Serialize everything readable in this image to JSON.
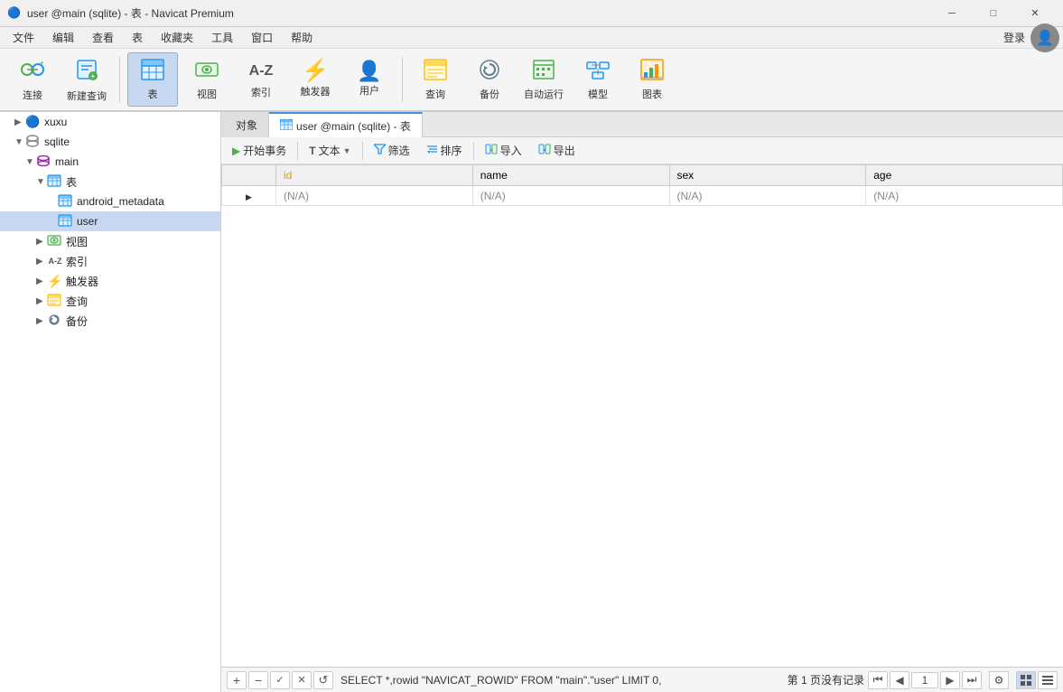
{
  "window": {
    "title": "user @main (sqlite) - 表 - Navicat Premium",
    "app_icon": "🔵"
  },
  "win_controls": {
    "minimize": "─",
    "maximize": "□",
    "close": "✕"
  },
  "menubar": {
    "items": [
      "文件",
      "编辑",
      "查看",
      "表",
      "收藏夹",
      "工具",
      "窗口",
      "帮助"
    ]
  },
  "toolbar": {
    "items": [
      {
        "id": "connect",
        "icon": "🔌",
        "label": "连接",
        "active": false
      },
      {
        "id": "new-query",
        "icon": "📋",
        "label": "新建查询",
        "active": false
      },
      {
        "id": "table",
        "icon": "⊞",
        "label": "表",
        "active": true
      },
      {
        "id": "view",
        "icon": "👁",
        "label": "视图",
        "active": false
      },
      {
        "id": "index",
        "icon": "A-Z",
        "label": "索引",
        "active": false
      },
      {
        "id": "trigger",
        "icon": "⚡",
        "label": "触发器",
        "active": false
      },
      {
        "id": "user",
        "icon": "👤",
        "label": "用户",
        "active": false
      },
      {
        "id": "query",
        "icon": "📊",
        "label": "查询",
        "active": false
      },
      {
        "id": "backup",
        "icon": "🔄",
        "label": "备份",
        "active": false
      },
      {
        "id": "automation",
        "icon": "📅",
        "label": "自动运行",
        "active": false
      },
      {
        "id": "model",
        "icon": "🗂",
        "label": "模型",
        "active": false
      },
      {
        "id": "chart",
        "icon": "📈",
        "label": "图表",
        "active": false
      }
    ],
    "login_label": "登录"
  },
  "sidebar": {
    "items": [
      {
        "id": "xuxu",
        "label": "xuxu",
        "indent": 0,
        "icon": "🔵",
        "expanded": false,
        "type": "connection"
      },
      {
        "id": "sqlite",
        "label": "sqlite",
        "indent": 0,
        "icon": "🗄",
        "expanded": true,
        "type": "connection"
      },
      {
        "id": "main",
        "label": "main",
        "indent": 1,
        "icon": "🗄",
        "expanded": true,
        "type": "schema"
      },
      {
        "id": "tables-group",
        "label": "表",
        "indent": 2,
        "icon": "⊞",
        "expanded": true,
        "type": "group"
      },
      {
        "id": "android_metadata",
        "label": "android_metadata",
        "indent": 3,
        "icon": "⊞",
        "expanded": false,
        "type": "table"
      },
      {
        "id": "user",
        "label": "user",
        "indent": 3,
        "icon": "⊞",
        "expanded": false,
        "type": "table",
        "selected": true
      },
      {
        "id": "views-group",
        "label": "视图",
        "indent": 2,
        "icon": "👁",
        "expanded": false,
        "type": "group"
      },
      {
        "id": "index-group",
        "label": "索引",
        "indent": 2,
        "icon": "AZ",
        "expanded": false,
        "type": "group"
      },
      {
        "id": "trigger-group",
        "label": "触发器",
        "indent": 2,
        "icon": "⚡",
        "expanded": false,
        "type": "group"
      },
      {
        "id": "query-group",
        "label": "查询",
        "indent": 2,
        "icon": "📊",
        "expanded": false,
        "type": "group"
      },
      {
        "id": "backup-group",
        "label": "备份",
        "indent": 2,
        "icon": "🔄",
        "expanded": false,
        "type": "group"
      }
    ]
  },
  "tabs": {
    "items": [
      {
        "id": "objects",
        "label": "对象",
        "icon": "",
        "active": false
      },
      {
        "id": "user-table",
        "label": "user @main (sqlite) - 表",
        "icon": "⊞",
        "active": true
      }
    ]
  },
  "table_toolbar": {
    "buttons": [
      {
        "id": "begin-transaction",
        "icon": "▶",
        "label": "开始事务"
      },
      {
        "id": "text",
        "icon": "T",
        "label": "文本",
        "has_arrow": true
      },
      {
        "id": "filter",
        "icon": "▽",
        "label": "筛选"
      },
      {
        "id": "sort",
        "icon": "↕",
        "label": "排序"
      },
      {
        "id": "import",
        "icon": "↓",
        "label": "导入"
      },
      {
        "id": "export",
        "icon": "↑",
        "label": "导出"
      }
    ]
  },
  "table": {
    "columns": [
      {
        "name": "id",
        "is_pk": true
      },
      {
        "name": "name",
        "is_pk": false
      },
      {
        "name": "sex",
        "is_pk": false
      },
      {
        "name": "age",
        "is_pk": false
      }
    ],
    "rows": [
      {
        "arrow": "▶",
        "id": "(N/A)",
        "name": "(N/A)",
        "sex": "(N/A)",
        "age": "(N/A)"
      }
    ]
  },
  "statusbar": {
    "sql_text": "SELECT *,rowid \"NAVICAT_ROWID\" FROM \"main\".\"user\" LIMIT 0,",
    "page_info": "第 1 页没有记录",
    "page_number": "1",
    "nav_first": "⏮",
    "nav_prev": "◀",
    "nav_next": "▶",
    "nav_last": "⏭"
  },
  "bottom_toolbar": {
    "add": "+",
    "delete": "−",
    "check": "✓",
    "cancel": "✕",
    "refresh": "↺"
  }
}
